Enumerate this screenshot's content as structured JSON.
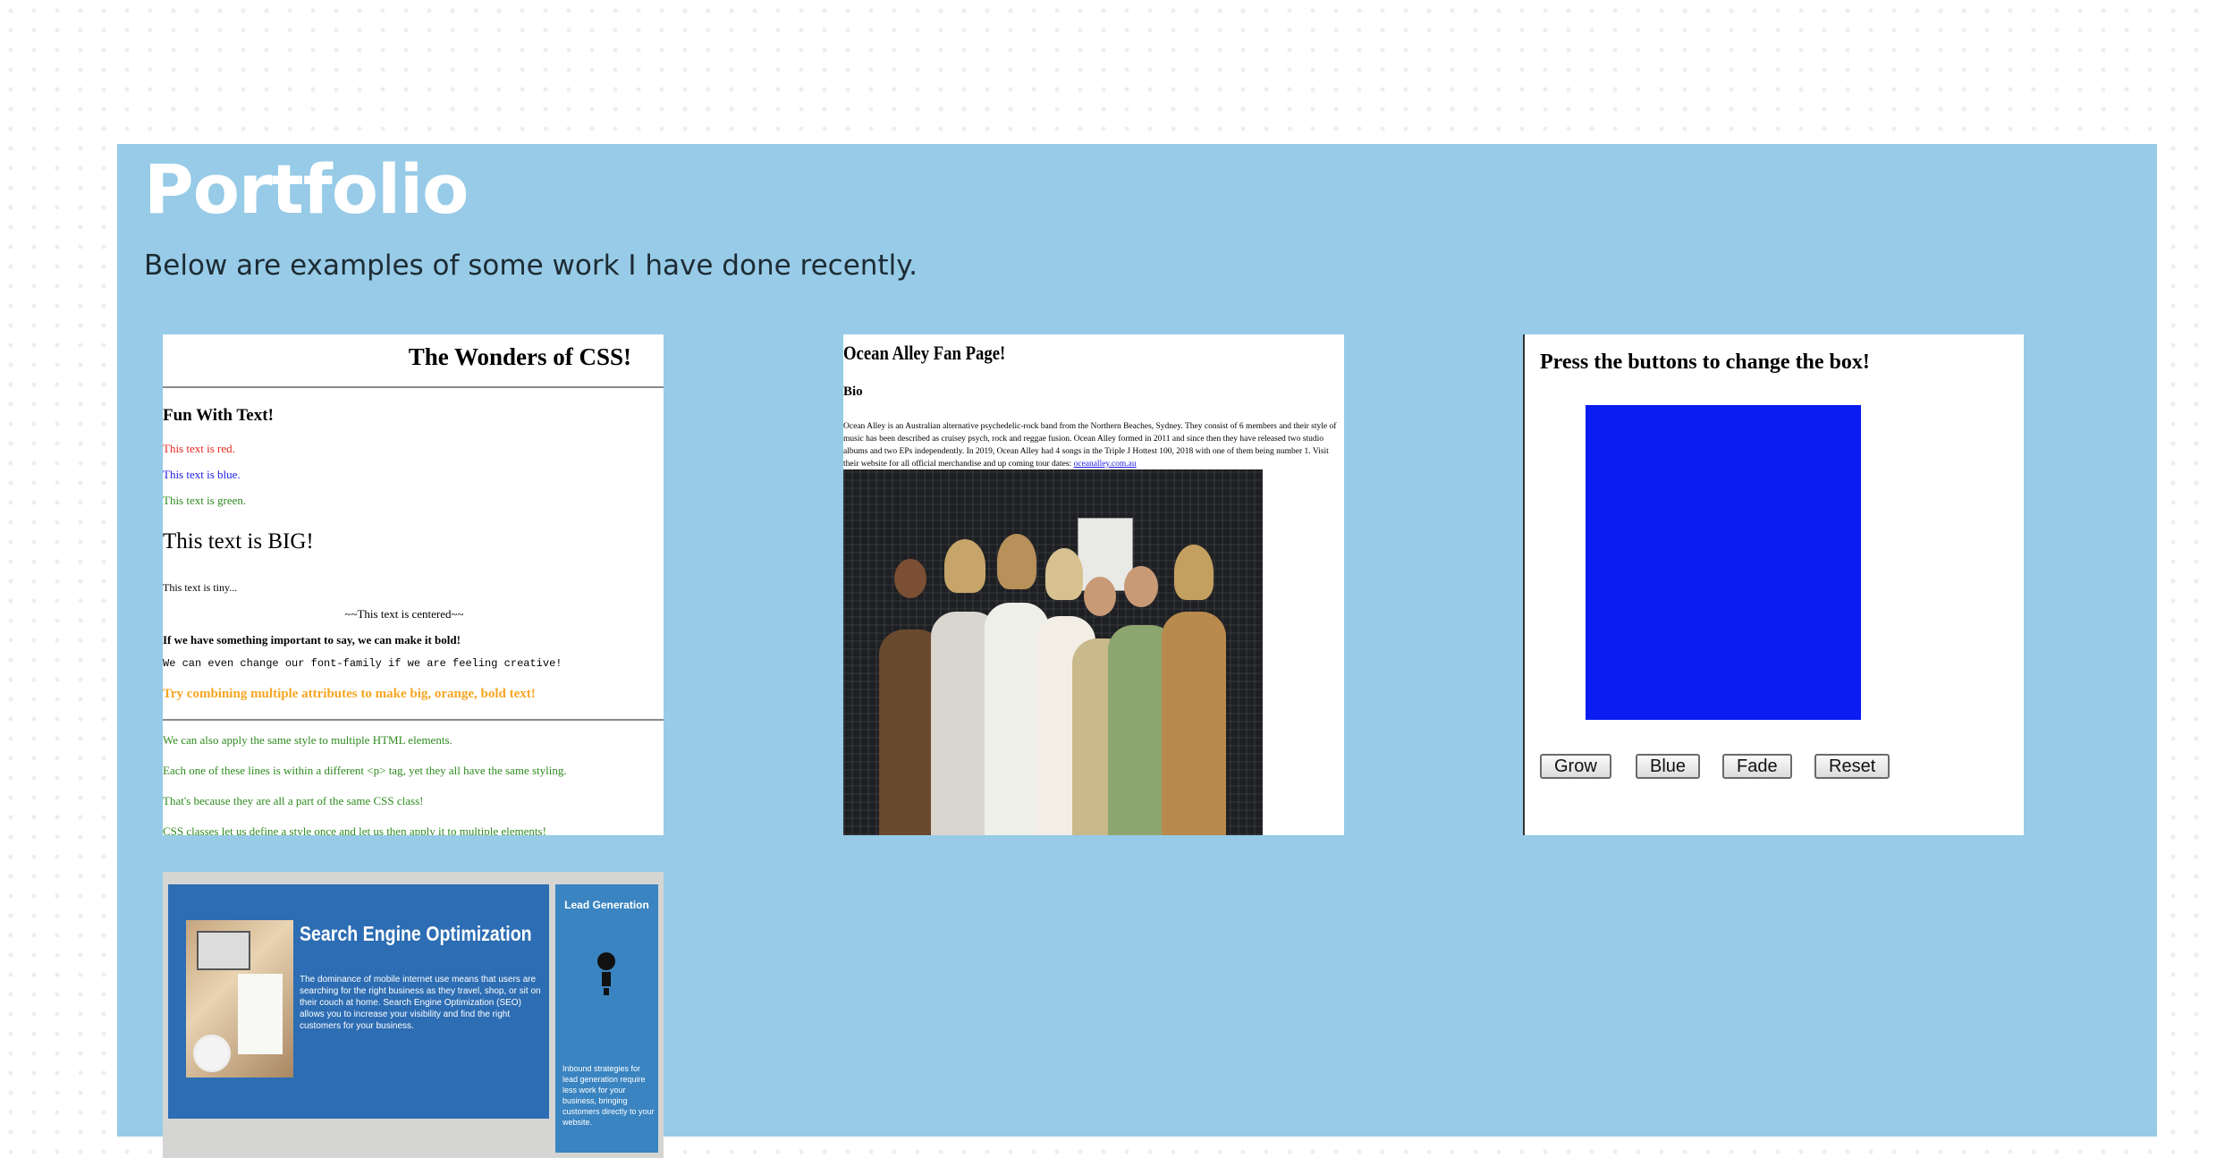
{
  "header": {
    "title": "Portfolio",
    "intro": "Below are examples of some work I have done recently."
  },
  "projects": [
    {
      "heading": "The Wonders of CSS!",
      "subheading": "Fun With Text!",
      "red": "This text is red.",
      "blue": "This text is blue.",
      "green": "This text is green.",
      "big": "This text is BIG!",
      "tiny": "This text is tiny...",
      "centered": "~~This text is centered~~",
      "bold": "If we have something important to say, we can make it bold!",
      "mono": "We can even change our font-family if we are feeling creative!",
      "orange": "Try combining multiple attributes to make big, orange, bold text!",
      "g1": "We can also apply the same style to multiple HTML elements.",
      "g2": "Each one of these lines is within a different <p> tag, yet they all have the same styling.",
      "g3": "That's because they are all a part of the same CSS class!",
      "g4": "CSS classes let us define a style once and let us then apply it to multiple elements!"
    },
    {
      "heading": "Ocean Alley Fan Page!",
      "bio_label": "Bio",
      "bio": "Ocean Alley is an Australian alternative psychedelic-rock band from the Northern Beaches, Sydney. They consist of 6 members and their style of music has been described as cruisey psych, rock and reggae fusion. Ocean Alley formed in 2011 and since then they have released two studio albums and two EPs independently. In 2019, Ocean Alley had 4 songs in the Triple J Hottest 100, 2018 with one of them being number 1. Visit their website for all official merchandise and up coming tour dates:",
      "link": "oceanalley.com.au"
    },
    {
      "heading": "Press the buttons to change the box!",
      "box_color": "#0a1cf2",
      "buttons": [
        "Grow",
        "Blue",
        "Fade",
        "Reset"
      ]
    },
    {
      "heading": "Search Engine Optimization",
      "body": "The dominance of mobile internet use means that users are searching for the right business as they travel, shop, or sit on their couch at home. Search Engine Optimization (SEO) allows you to increase your visibility and find the right customers for your business.",
      "side_heading": "Lead Generation",
      "side_body": "Inbound strategies for lead generation require less work for your business, bringing customers directly to your website."
    }
  ],
  "colors": {
    "panel": "#97cbe7",
    "title": "#ffffff"
  }
}
